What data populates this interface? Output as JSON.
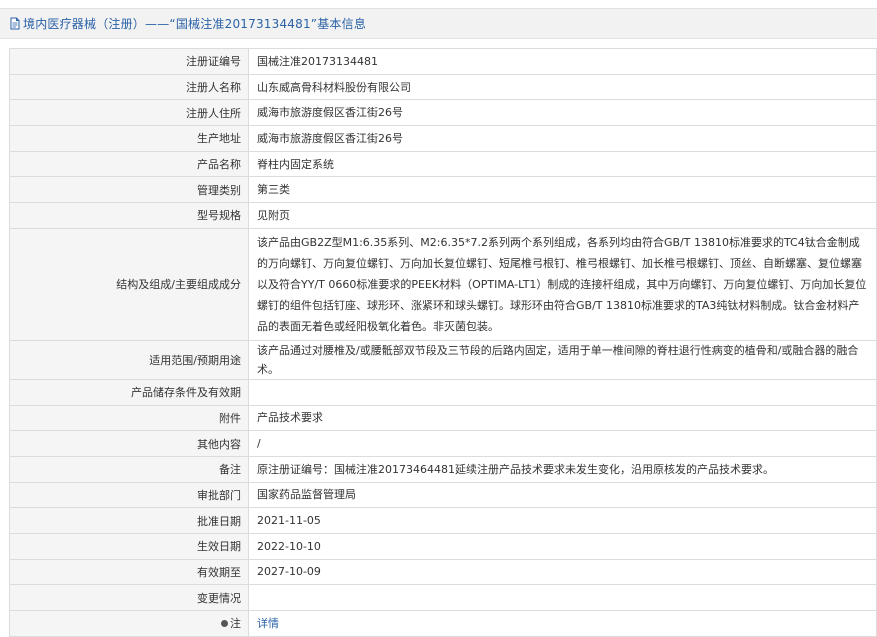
{
  "header": {
    "title": "境内医疗器械（注册）——“国械注准20173134481”基本信息"
  },
  "rows": [
    {
      "label": "注册证编号",
      "value": "国械注准20173134481"
    },
    {
      "label": "注册人名称",
      "value": "山东威高骨科材料股份有限公司"
    },
    {
      "label": "注册人住所",
      "value": "威海市旅游度假区香江街26号"
    },
    {
      "label": "生产地址",
      "value": "威海市旅游度假区香江街26号"
    },
    {
      "label": "产品名称",
      "value": "脊柱内固定系统"
    },
    {
      "label": "管理类别",
      "value": "第三类"
    },
    {
      "label": "型号规格",
      "value": "见附页"
    },
    {
      "label": "结构及组成/主要组成成分",
      "value": "该产品由GB2Z型M1:6.35系列、M2:6.35*7.2系列两个系列组成，各系列均由符合GB/T 13810标准要求的TC4钛合金制成的万向螺钉、万向复位螺钉、万向加长复位螺钉、短尾椎弓根钉、椎弓根螺钉、加长椎弓根螺钉、顶丝、自断螺塞、复位螺塞以及符合YY/T 0660标准要求的PEEK材料（OPTIMA-LT1）制成的连接杆组成，其中万向螺钉、万向复位螺钉、万向加长复位螺钉的组件包括钉座、球形环、涨紧环和球头螺钉。球形环由符合GB/T 13810标准要求的TA3纯钛材料制成。钛合金材料产品的表面无着色或经阳极氧化着色。非灭菌包装。"
    },
    {
      "label": "适用范围/预期用途",
      "value": "该产品通过对腰椎及/或腰骶部双节段及三节段的后路内固定，适用于单一椎间隙的脊柱退行性病变的植骨和/或融合器的融合术。"
    },
    {
      "label": "产品储存条件及有效期",
      "value": ""
    },
    {
      "label": "附件",
      "value": "产品技术要求"
    },
    {
      "label": "其他内容",
      "value": "/"
    },
    {
      "label": "备注",
      "value": "原注册证编号：国械注准20173464481延续注册产品技术要求未发生变化，沿用原核发的产品技术要求。"
    },
    {
      "label": "审批部门",
      "value": "国家药品监督管理局"
    },
    {
      "label": "批准日期",
      "value": "2021-11-05"
    },
    {
      "label": "生效日期",
      "value": "2022-10-10"
    },
    {
      "label": "有效期至",
      "value": "2027-10-09"
    },
    {
      "label": "变更情况",
      "value": ""
    },
    {
      "label": "注",
      "value": "详情"
    }
  ],
  "colors": {
    "link": "#2a62a8",
    "label_bg": "#f5f5f5",
    "header_bg": "#f2f2f2"
  },
  "icons": {
    "header": "document-icon",
    "note": "pin-icon"
  }
}
